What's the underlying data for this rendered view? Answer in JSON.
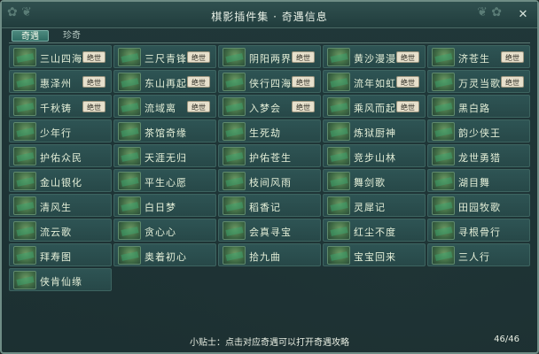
{
  "window": {
    "title": "棋影插件集 · 奇遇信息",
    "close_icon": "close-icon"
  },
  "tabs": [
    {
      "label": "奇遇",
      "active": true
    },
    {
      "label": "珍奇",
      "active": false
    }
  ],
  "encounters": [
    {
      "name": "三山四海",
      "badge": "绝世"
    },
    {
      "name": "三尺青锋",
      "badge": "绝世"
    },
    {
      "name": "阴阳两界",
      "badge": "绝世"
    },
    {
      "name": "黄沙漫漫",
      "badge": "绝世"
    },
    {
      "name": "济苍生",
      "badge": "绝世"
    },
    {
      "name": "惠泽州",
      "badge": "绝世"
    },
    {
      "name": "东山再起",
      "badge": "绝世"
    },
    {
      "name": "侠行四海",
      "badge": "绝世"
    },
    {
      "name": "流年如虹",
      "badge": "绝世"
    },
    {
      "name": "万灵当歌",
      "badge": "绝世"
    },
    {
      "name": "千秋铸",
      "badge": "绝世"
    },
    {
      "name": "流域离",
      "badge": "绝世"
    },
    {
      "name": "入梦会",
      "badge": "绝世"
    },
    {
      "name": "乘风而起",
      "badge": "绝世"
    },
    {
      "name": "黑白路",
      "badge": ""
    },
    {
      "name": "少年行",
      "badge": ""
    },
    {
      "name": "茶馆奇缘",
      "badge": ""
    },
    {
      "name": "生死劫",
      "badge": ""
    },
    {
      "name": "炼狱厨神",
      "badge": ""
    },
    {
      "name": "韵少侠王",
      "badge": ""
    },
    {
      "name": "护佑众民",
      "badge": ""
    },
    {
      "name": "天涯无归",
      "badge": ""
    },
    {
      "name": "护佑苍生",
      "badge": ""
    },
    {
      "name": "竞步山林",
      "badge": ""
    },
    {
      "name": "龙世勇猎",
      "badge": ""
    },
    {
      "name": "金山银化",
      "badge": ""
    },
    {
      "name": "平生心愿",
      "badge": ""
    },
    {
      "name": "枝间风雨",
      "badge": ""
    },
    {
      "name": "舞剑歌",
      "badge": ""
    },
    {
      "name": "湖目舞",
      "badge": ""
    },
    {
      "name": "清风生",
      "badge": ""
    },
    {
      "name": "白日梦",
      "badge": ""
    },
    {
      "name": "稻香记",
      "badge": ""
    },
    {
      "name": "灵犀记",
      "badge": ""
    },
    {
      "name": "田园牧歌",
      "badge": ""
    },
    {
      "name": "流云歌",
      "badge": ""
    },
    {
      "name": "贪心心",
      "badge": ""
    },
    {
      "name": "会真寻宝",
      "badge": ""
    },
    {
      "name": "红尘不度",
      "badge": ""
    },
    {
      "name": "寻根骨行",
      "badge": ""
    },
    {
      "name": "拜寿图",
      "badge": ""
    },
    {
      "name": "奥着初心",
      "badge": ""
    },
    {
      "name": "拾九曲",
      "badge": ""
    },
    {
      "name": "宝宝回来",
      "badge": ""
    },
    {
      "name": "三人行",
      "badge": ""
    },
    {
      "name": "侠肯仙缘",
      "badge": ""
    }
  ],
  "footer": {
    "tip": "小贴士：点击对应奇遇可以打开奇遇攻略",
    "count": "46/46"
  }
}
